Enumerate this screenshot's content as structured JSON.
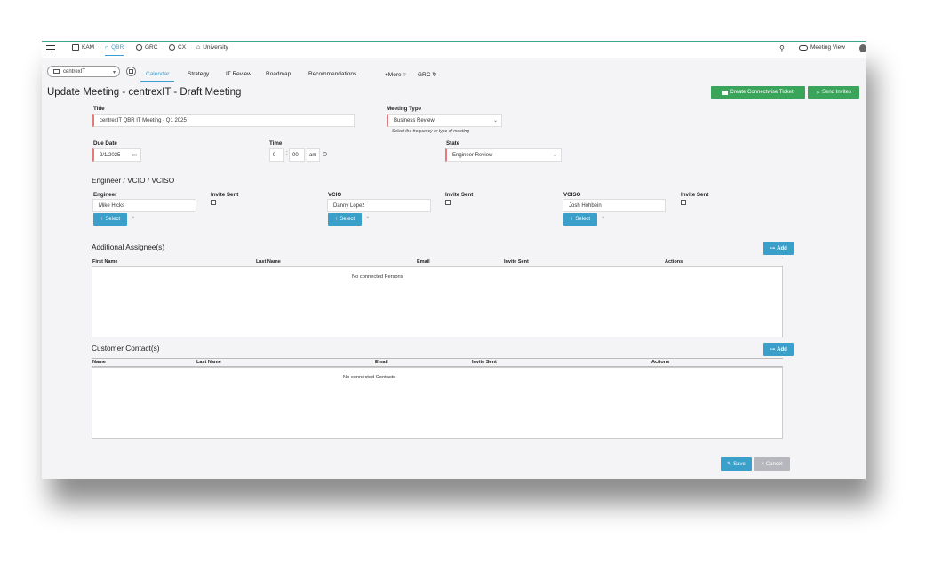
{
  "nav": {
    "items": [
      {
        "label": "KAM"
      },
      {
        "label": "QBR"
      },
      {
        "label": "GRC"
      },
      {
        "label": "CX"
      },
      {
        "label": "University"
      }
    ],
    "meeting_view": "Meeting View"
  },
  "client_select": {
    "value": "centrexIT"
  },
  "tabs": [
    {
      "label": "Calendar"
    },
    {
      "label": "Strategy"
    },
    {
      "label": "IT Review"
    },
    {
      "label": "Roadmap"
    },
    {
      "label": "Recommendations"
    },
    {
      "label": "+More"
    },
    {
      "label": "GRC"
    }
  ],
  "page_title": "Update Meeting - centrexIT - Draft Meeting",
  "actions": {
    "create_ticket": "Create Connectwise Ticket",
    "send_invites": "Send Invites"
  },
  "form": {
    "title_label": "Title",
    "title_value": "centrexIT  QBR IT Meeting - Q1 2025",
    "meeting_type_label": "Meeting Type",
    "meeting_type_value": "Business Review",
    "meeting_type_help": "Select the frequency or type of meeting",
    "due_date_label": "Due Date",
    "due_date_value": "2/1/2025",
    "time_label": "Time",
    "time_hour": "9",
    "time_minute": "00",
    "time_ampm": "am",
    "state_label": "State",
    "state_value": "Engineer Review"
  },
  "roles_section": "Engineer / VCIO / VCISO",
  "roles": [
    {
      "label": "Engineer",
      "value": "Mike Hicks",
      "invite_label": "Invite Sent",
      "select_label": "Select"
    },
    {
      "label": "VCIO",
      "value": "Danny Lopez",
      "invite_label": "Invite Sent",
      "select_label": "Select"
    },
    {
      "label": "VCISO",
      "value": "Josh Hohbein",
      "invite_label": "Invite Sent",
      "select_label": "Select"
    }
  ],
  "assignees": {
    "title": "Additional Assignee(s)",
    "add_label": "Add",
    "columns": [
      "First Name",
      "Last Name",
      "Email",
      "Invite Sent",
      "Actions"
    ],
    "empty": "No connected Persons"
  },
  "contacts": {
    "title": "Customer Contact(s)",
    "add_label": "Add",
    "columns": [
      "Name",
      "Last Name",
      "Email",
      "Invite Sent",
      "Actions"
    ],
    "empty": "No connected Contacts"
  },
  "footer": {
    "save": "Save",
    "cancel": "Cancel"
  },
  "colors": {
    "accent": "#3a9fd0",
    "green": "#3aa55a",
    "required": "#e57a7a"
  }
}
